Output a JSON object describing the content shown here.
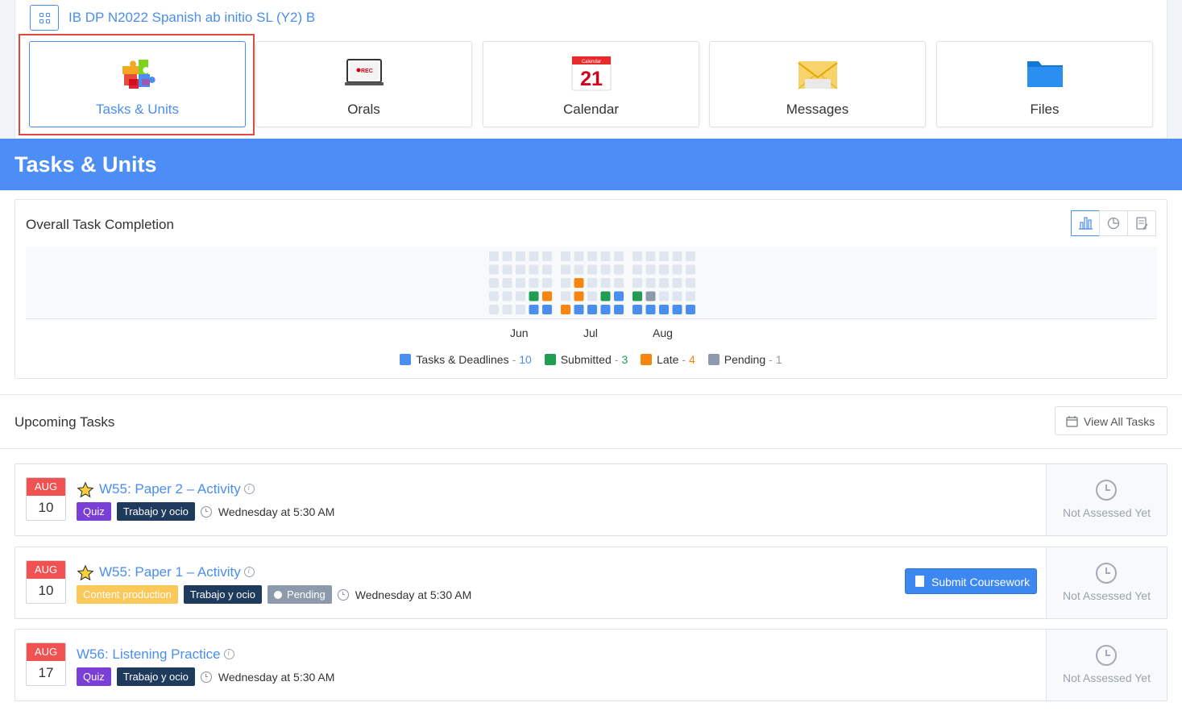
{
  "course": {
    "title": "IB DP N2022 Spanish ab initio SL (Y2) B"
  },
  "nav": [
    {
      "label": "Tasks & Units",
      "icon": "puzzle-icon",
      "active": true
    },
    {
      "label": "Orals",
      "icon": "rec-laptop-icon",
      "active": false
    },
    {
      "label": "Calendar",
      "icon": "calendar-21-icon",
      "active": false
    },
    {
      "label": "Messages",
      "icon": "envelope-icon",
      "active": false
    },
    {
      "label": "Files",
      "icon": "folder-icon",
      "active": false
    }
  ],
  "calendar_icon": {
    "header": "Calendar",
    "day": "21"
  },
  "orals_icon": {
    "text": "REC"
  },
  "banner": {
    "title": "Tasks & Units"
  },
  "completion": {
    "title": "Overall Task Completion",
    "months": [
      "Jun",
      "Jul",
      "Aug"
    ],
    "legend": [
      {
        "label": "Tasks & Deadlines",
        "count": "10",
        "color": "#4a8ef0"
      },
      {
        "label": "Submitted",
        "count": "3",
        "color": "#1f9d55"
      },
      {
        "label": "Late",
        "count": "4",
        "color": "#f6860f"
      },
      {
        "label": "Pending",
        "count": "1",
        "color": "#8c9aab"
      }
    ],
    "colors": {
      "empty": "#dfe6ef",
      "task": "#4a8ef0",
      "submitted": "#1f9d55",
      "late": "#f6860f",
      "pending": "#8c9aab"
    }
  },
  "upcoming": {
    "title": "Upcoming Tasks",
    "view_all_label": "View All Tasks"
  },
  "tasks": [
    {
      "month": "AUG",
      "day": "10",
      "starred": true,
      "title": "W55: Paper 2 – Activity",
      "tags": [
        "Quiz",
        "Trabajo y ocio"
      ],
      "due": "Wednesday at 5:30 AM",
      "status": "Not Assessed Yet"
    },
    {
      "month": "AUG",
      "day": "10",
      "starred": true,
      "title": "W55: Paper 1 – Activity",
      "tags": [
        "Content production",
        "Trabajo y ocio",
        "Pending"
      ],
      "due": "Wednesday at 5:30 AM",
      "action": "Submit Coursework",
      "status": "Not Assessed Yet"
    },
    {
      "month": "AUG",
      "day": "17",
      "starred": false,
      "title": "W56: Listening Practice",
      "tags": [
        "Quiz",
        "Trabajo y ocio"
      ],
      "due": "Wednesday at 5:30 AM",
      "status": "Not Assessed Yet"
    }
  ]
}
